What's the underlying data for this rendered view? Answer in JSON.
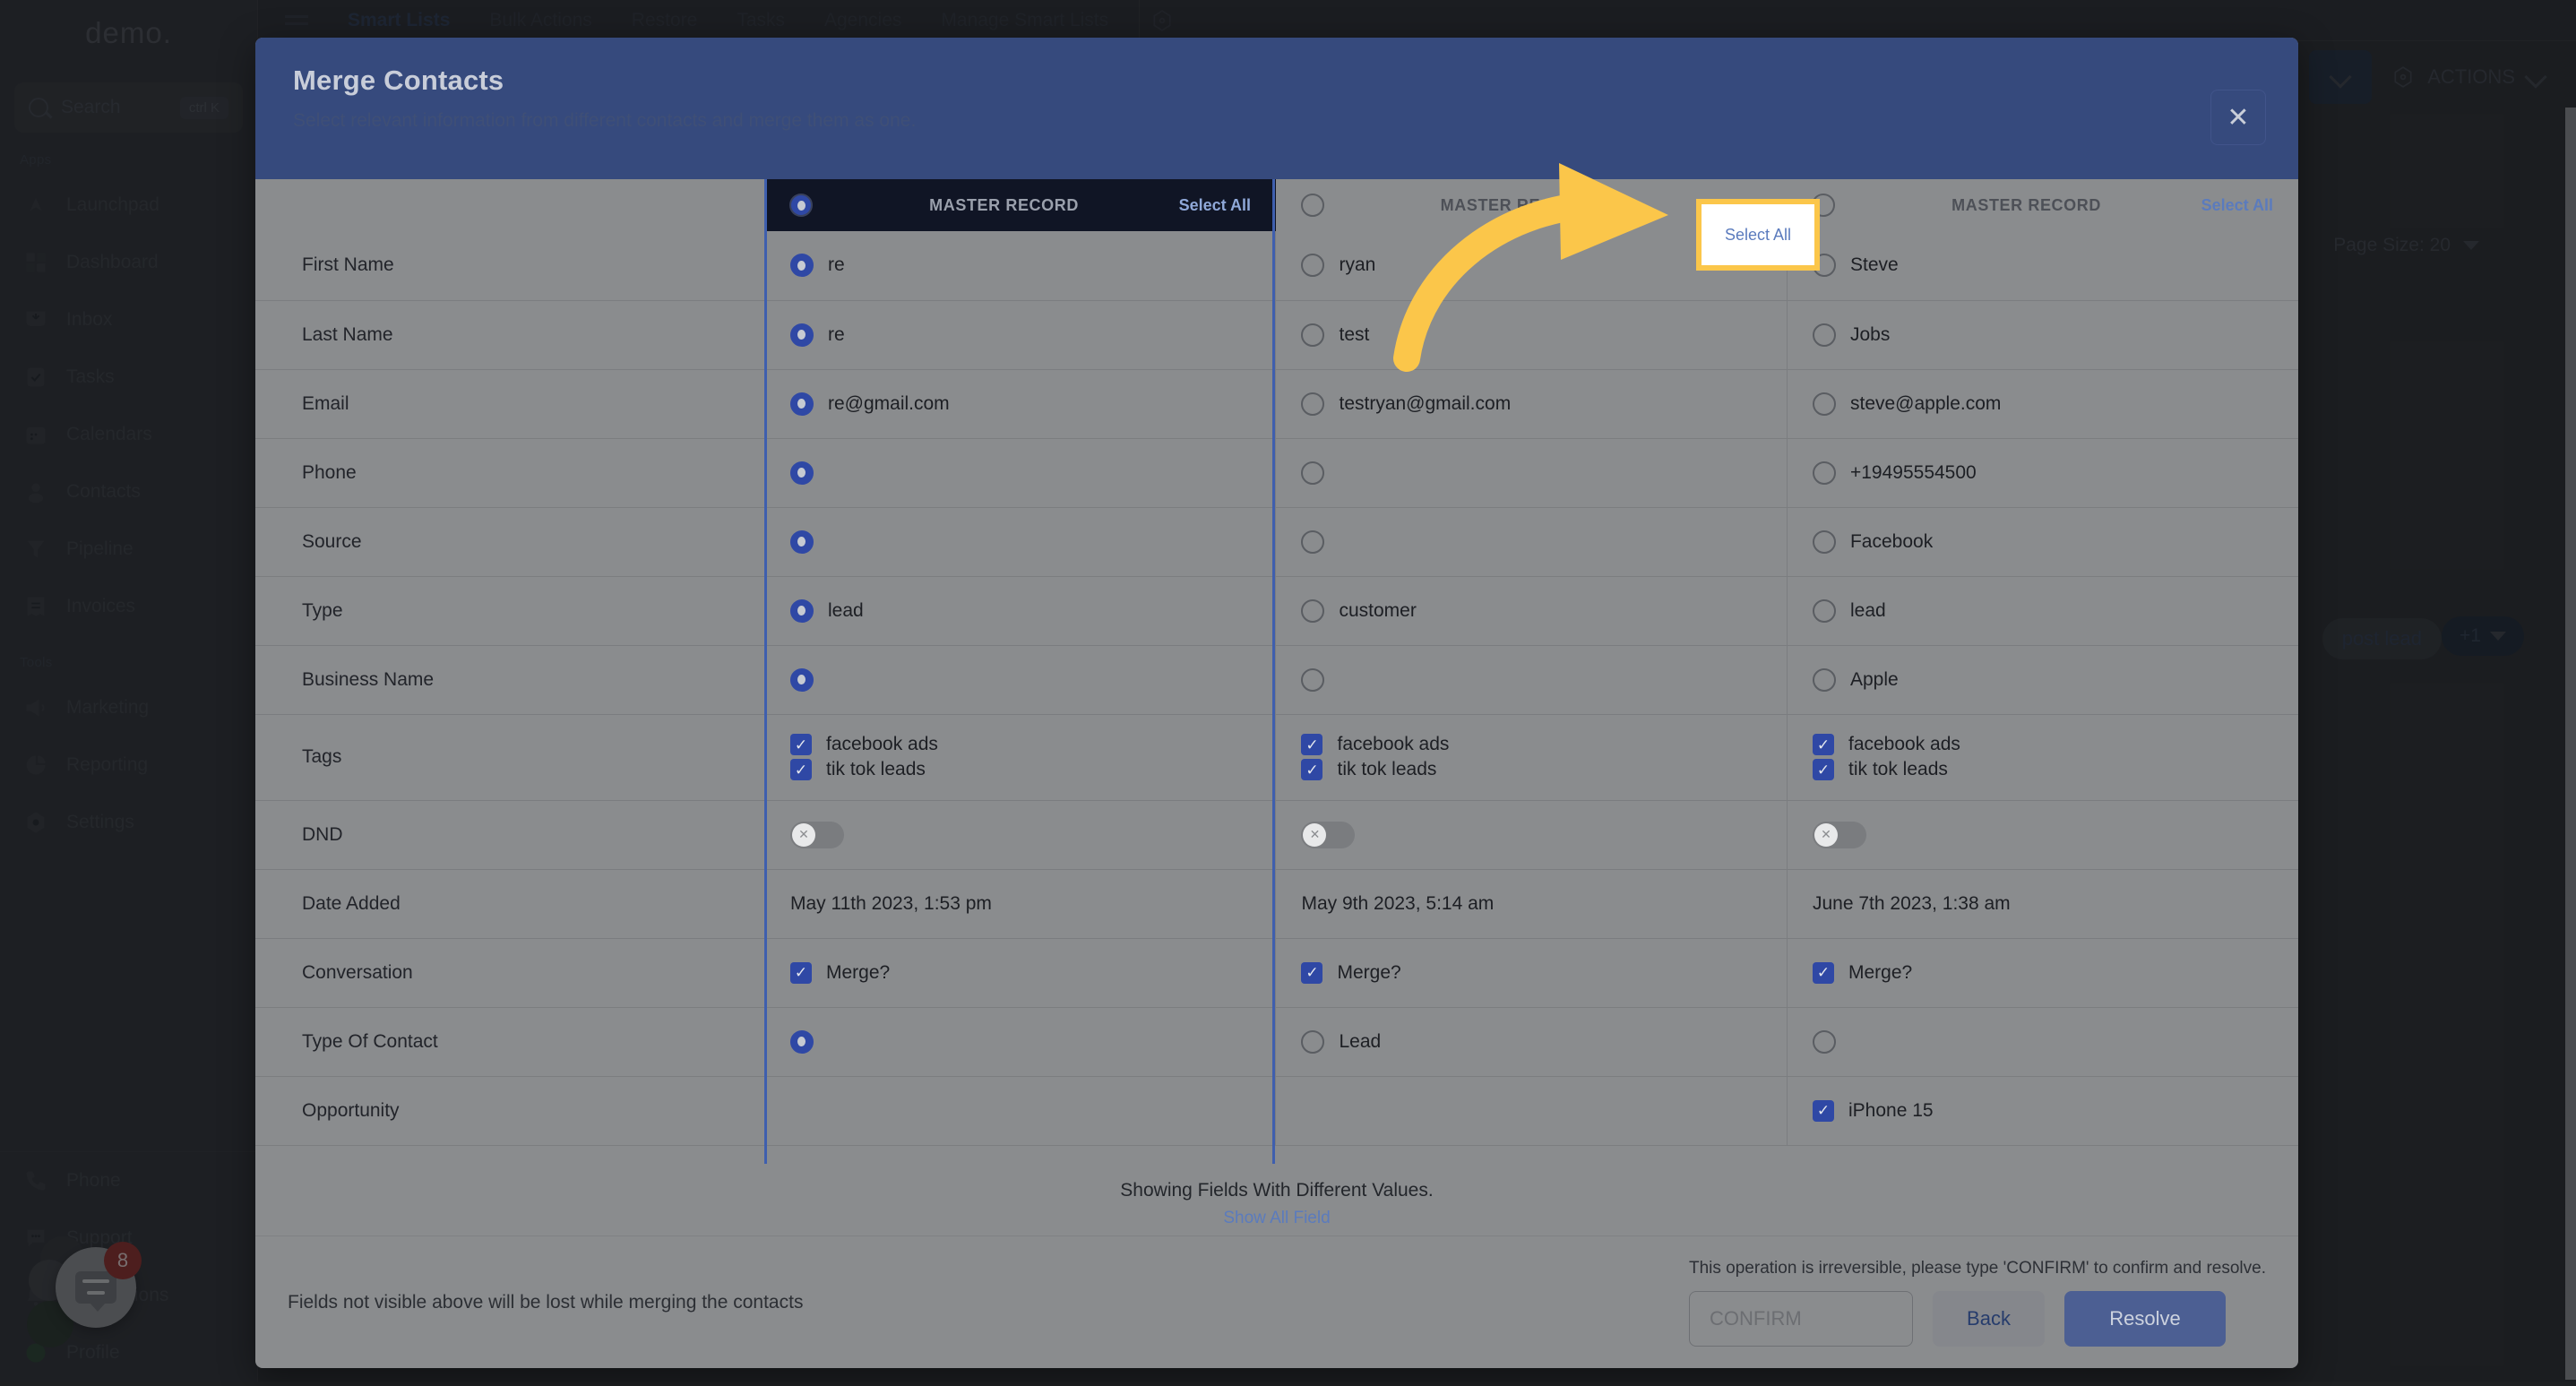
{
  "background": {
    "brand": "demo.",
    "search": {
      "label": "Search",
      "shortcut": "ctrl K",
      "icon": "search-icon"
    },
    "nav_groups": [
      {
        "label": "Apps",
        "items": [
          {
            "label": "Launchpad",
            "icon": "launchpad-icon"
          },
          {
            "label": "Dashboard",
            "icon": "dashboard-icon"
          },
          {
            "label": "Inbox",
            "icon": "inbox-icon"
          },
          {
            "label": "Tasks",
            "icon": "tasks-icon"
          },
          {
            "label": "Calendars",
            "icon": "calendar-icon"
          },
          {
            "label": "Contacts",
            "icon": "contacts-icon"
          },
          {
            "label": "Pipeline",
            "icon": "pipeline-icon"
          },
          {
            "label": "Invoices",
            "icon": "invoices-icon"
          }
        ]
      },
      {
        "label": "Tools",
        "items": [
          {
            "label": "Marketing",
            "icon": "megaphone-icon"
          },
          {
            "label": "Reporting",
            "icon": "pie-chart-icon"
          },
          {
            "label": "Settings",
            "icon": "gear-icon"
          }
        ]
      }
    ],
    "bottom_items": [
      {
        "label": "Phone",
        "icon": "phone-icon"
      },
      {
        "label": "Support",
        "icon": "chat-icon"
      },
      {
        "label": "Notifications",
        "icon": "bell-icon"
      },
      {
        "label": "Profile",
        "icon": "avatar-icon"
      }
    ],
    "topbar_tabs": [
      {
        "label": "Smart Lists",
        "active": true
      },
      {
        "label": "Bulk Actions",
        "active": false
      },
      {
        "label": "Restore",
        "active": false
      },
      {
        "label": "Tasks",
        "active": false
      },
      {
        "label": "Agencies",
        "active": false
      },
      {
        "label": "Manage Smart Lists",
        "active": false
      }
    ],
    "actions_label": "ACTIONS",
    "page_size": "Page Size: 20",
    "add_lead_label": "post lead",
    "plus_one_label": "+1",
    "chat_badge": "8"
  },
  "modal": {
    "title": "Merge Contacts",
    "subtitle": "Select relevant information from different contacts and merge them as one.",
    "close_icon": "close-icon",
    "columns": [
      {
        "header": "MASTER RECORD",
        "select_all": "Select All",
        "is_master": true,
        "highlighted": false
      },
      {
        "header": "MASTER RECORD",
        "select_all": "Select All",
        "is_master": false,
        "highlighted": true
      },
      {
        "header": "MASTER RECORD",
        "select_all": "Select All",
        "is_master": false,
        "highlighted": false
      }
    ],
    "rows": [
      {
        "label": "First Name",
        "type": "radio",
        "cells": [
          {
            "selected": true,
            "text": "re"
          },
          {
            "selected": false,
            "text": "ryan"
          },
          {
            "selected": false,
            "text": "Steve"
          }
        ]
      },
      {
        "label": "Last Name",
        "type": "radio",
        "cells": [
          {
            "selected": true,
            "text": "re"
          },
          {
            "selected": false,
            "text": "test"
          },
          {
            "selected": false,
            "text": "Jobs"
          }
        ]
      },
      {
        "label": "Email",
        "type": "radio",
        "cells": [
          {
            "selected": true,
            "text": "re@gmail.com"
          },
          {
            "selected": false,
            "text": "testryan@gmail.com"
          },
          {
            "selected": false,
            "text": "steve@apple.com"
          }
        ]
      },
      {
        "label": "Phone",
        "type": "radio",
        "cells": [
          {
            "selected": true,
            "text": ""
          },
          {
            "selected": false,
            "text": ""
          },
          {
            "selected": false,
            "text": "+19495554500"
          }
        ]
      },
      {
        "label": "Source",
        "type": "radio",
        "cells": [
          {
            "selected": true,
            "text": ""
          },
          {
            "selected": false,
            "text": ""
          },
          {
            "selected": false,
            "text": "Facebook"
          }
        ]
      },
      {
        "label": "Type",
        "type": "radio",
        "cells": [
          {
            "selected": true,
            "text": "lead"
          },
          {
            "selected": false,
            "text": "customer"
          },
          {
            "selected": false,
            "text": "lead"
          }
        ]
      },
      {
        "label": "Business Name",
        "type": "radio",
        "cells": [
          {
            "selected": true,
            "text": ""
          },
          {
            "selected": false,
            "text": ""
          },
          {
            "selected": false,
            "text": "Apple"
          }
        ]
      },
      {
        "label": "Tags",
        "type": "checkbox-list",
        "cells": [
          {
            "items": [
              {
                "checked": true,
                "text": "facebook ads"
              },
              {
                "checked": true,
                "text": "tik tok leads"
              }
            ]
          },
          {
            "items": [
              {
                "checked": true,
                "text": "facebook ads"
              },
              {
                "checked": true,
                "text": "tik tok leads"
              }
            ]
          },
          {
            "items": [
              {
                "checked": true,
                "text": "facebook ads"
              },
              {
                "checked": true,
                "text": "tik tok leads"
              }
            ]
          }
        ]
      },
      {
        "label": "DND",
        "type": "toggle",
        "cells": [
          {
            "on": false,
            "knob_icon": "x-icon"
          },
          {
            "on": false,
            "knob_icon": "x-icon"
          },
          {
            "on": false,
            "knob_icon": "x-icon"
          }
        ]
      },
      {
        "label": "Date Added",
        "type": "text",
        "cells": [
          {
            "text": "May 11th 2023, 1:53 pm"
          },
          {
            "text": "May 9th 2023, 5:14 am"
          },
          {
            "text": "June 7th 2023, 1:38 am"
          }
        ]
      },
      {
        "label": "Conversation",
        "type": "checkbox",
        "cells": [
          {
            "checked": true,
            "text": "Merge?"
          },
          {
            "checked": true,
            "text": "Merge?"
          },
          {
            "checked": true,
            "text": "Merge?"
          }
        ]
      },
      {
        "label": "Type Of Contact",
        "type": "radio",
        "cells": [
          {
            "selected": true,
            "text": ""
          },
          {
            "selected": false,
            "text": "Lead"
          },
          {
            "selected": false,
            "text": ""
          }
        ]
      },
      {
        "label": "Opportunity",
        "type": "checkbox",
        "cells": [
          {
            "checked": null,
            "text": ""
          },
          {
            "checked": null,
            "text": ""
          },
          {
            "checked": true,
            "text": "iPhone 15"
          }
        ]
      }
    ],
    "showing_note": "Showing Fields With Different Values.",
    "show_all_link": "Show All Field",
    "footer_note": "Fields not visible above will be lost while merging the contacts",
    "irreversible_note": "This operation is irreversible, please type 'CONFIRM' to confirm and resolve.",
    "confirm_placeholder": "CONFIRM",
    "confirm_value": "",
    "back_label": "Back",
    "resolve_label": "Resolve"
  },
  "annotation": {
    "arrow_color": "#FBC64A",
    "highlight_color": "#FBC64A",
    "target": "Select All"
  }
}
